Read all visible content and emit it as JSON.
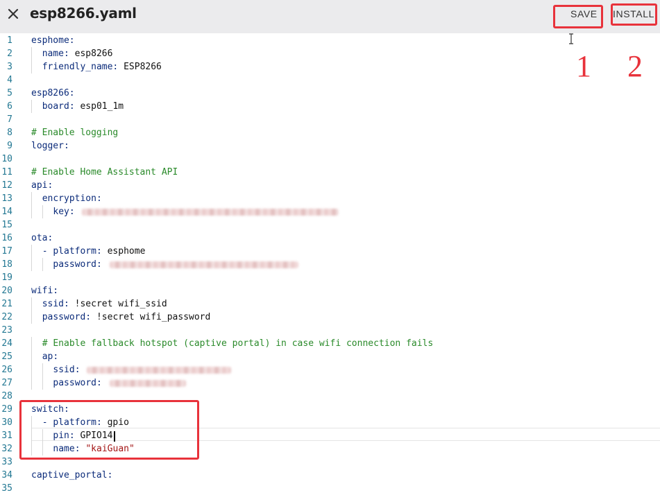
{
  "header": {
    "title": "esp8266.yaml",
    "save_label": "SAVE",
    "install_label": "INSTALL",
    "close_icon": "close-icon"
  },
  "annotations": {
    "one": "1",
    "two": "2"
  },
  "colors": {
    "annotation_red": "#e8323b",
    "key_blue": "#0b2b7a",
    "comment_green": "#2a8a2a",
    "string_red": "#a31515",
    "line_number": "#237893"
  },
  "editor": {
    "cursor_line": 31,
    "lines": [
      {
        "n": "1",
        "k": "esphome:",
        "v": "",
        "c": ""
      },
      {
        "n": "2",
        "k": "name:",
        "v": " esp8266",
        "c": ""
      },
      {
        "n": "3",
        "k": "friendly_name:",
        "v": " ESP8266",
        "c": ""
      },
      {
        "n": "4",
        "k": "",
        "v": "",
        "c": ""
      },
      {
        "n": "5",
        "k": "esp8266:",
        "v": "",
        "c": ""
      },
      {
        "n": "6",
        "k": "board:",
        "v": " esp01_1m",
        "c": ""
      },
      {
        "n": "7",
        "k": "",
        "v": "",
        "c": ""
      },
      {
        "n": "8",
        "k": "",
        "v": "",
        "c": "# Enable logging"
      },
      {
        "n": "9",
        "k": "logger:",
        "v": "",
        "c": ""
      },
      {
        "n": "10",
        "k": "",
        "v": "",
        "c": ""
      },
      {
        "n": "11",
        "k": "",
        "v": "",
        "c": "# Enable Home Assistant API"
      },
      {
        "n": "12",
        "k": "api:",
        "v": "",
        "c": ""
      },
      {
        "n": "13",
        "k": "encryption:",
        "v": "",
        "c": ""
      },
      {
        "n": "14",
        "k": "key:",
        "v": "",
        "c": ""
      },
      {
        "n": "15",
        "k": "",
        "v": "",
        "c": ""
      },
      {
        "n": "16",
        "k": "ota:",
        "v": "",
        "c": ""
      },
      {
        "n": "17",
        "k": "- platform:",
        "v": " esphome",
        "c": ""
      },
      {
        "n": "18",
        "k": "password:",
        "v": "",
        "c": ""
      },
      {
        "n": "19",
        "k": "",
        "v": "",
        "c": ""
      },
      {
        "n": "20",
        "k": "wifi:",
        "v": "",
        "c": ""
      },
      {
        "n": "21",
        "k": "ssid:",
        "v": " !secret wifi_ssid",
        "c": ""
      },
      {
        "n": "22",
        "k": "password:",
        "v": " !secret wifi_password",
        "c": ""
      },
      {
        "n": "23",
        "k": "",
        "v": "",
        "c": ""
      },
      {
        "n": "24",
        "k": "",
        "v": "",
        "c": "# Enable fallback hotspot (captive portal) in case wifi connection fails"
      },
      {
        "n": "25",
        "k": "ap:",
        "v": "",
        "c": ""
      },
      {
        "n": "26",
        "k": "ssid:",
        "v": "",
        "c": ""
      },
      {
        "n": "27",
        "k": "password:",
        "v": "",
        "c": ""
      },
      {
        "n": "28",
        "k": "",
        "v": "",
        "c": ""
      },
      {
        "n": "29",
        "k": "switch:",
        "v": "",
        "c": ""
      },
      {
        "n": "30",
        "k": "- platform:",
        "v": " gpio",
        "c": ""
      },
      {
        "n": "31",
        "k": "pin:",
        "v": " GPIO14",
        "c": ""
      },
      {
        "n": "32",
        "k": "name:",
        "v": " ",
        "s": "\"kaiGuan\"",
        "c": ""
      },
      {
        "n": "33",
        "k": "",
        "v": "",
        "c": ""
      },
      {
        "n": "34",
        "k": "captive_portal:",
        "v": "",
        "c": ""
      },
      {
        "n": "35",
        "k": "",
        "v": "",
        "c": ""
      }
    ]
  }
}
